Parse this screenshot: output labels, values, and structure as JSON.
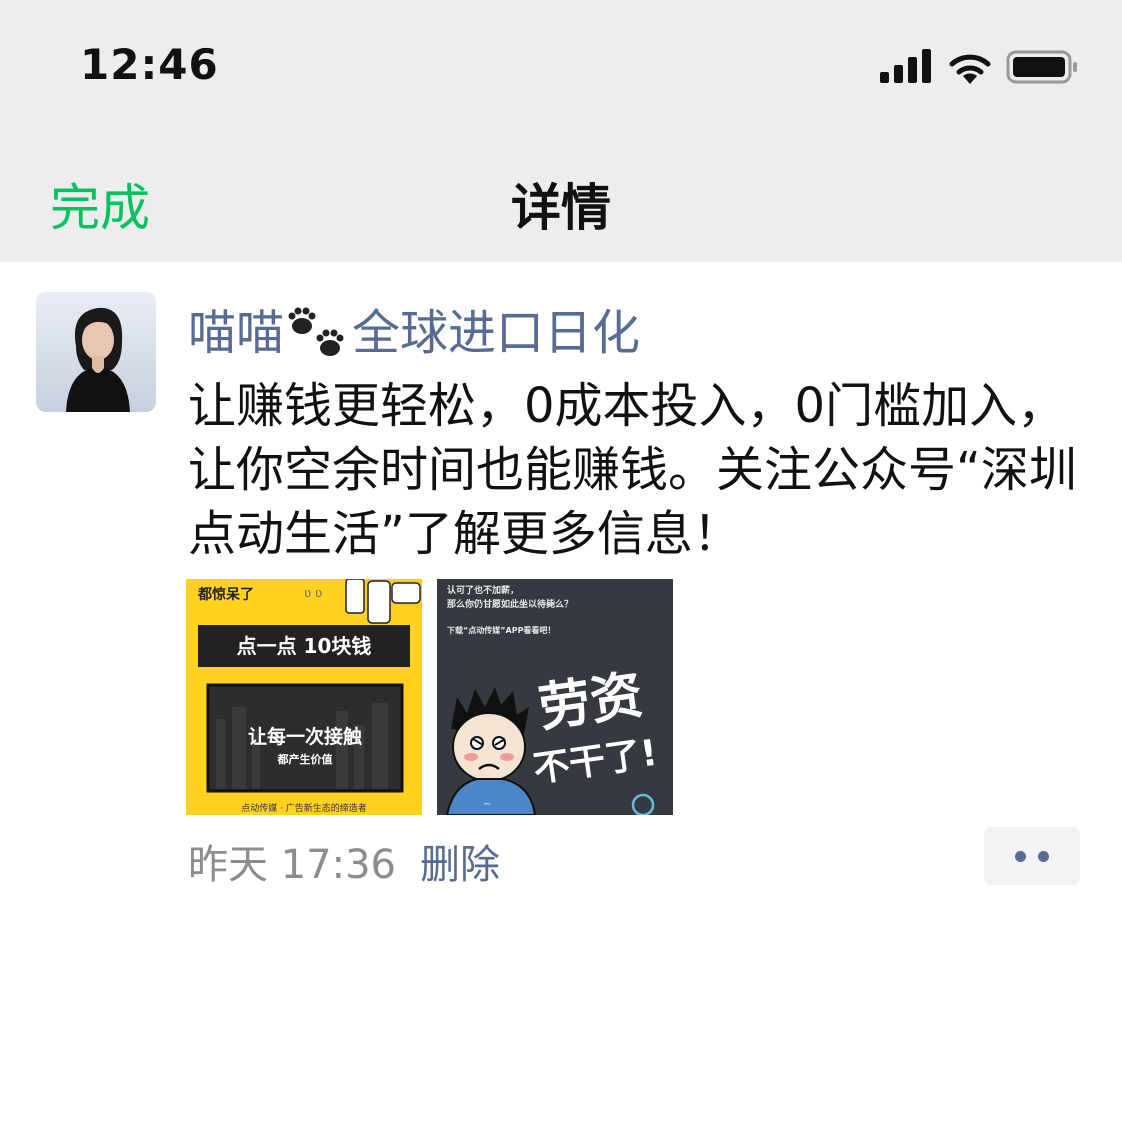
{
  "status_bar": {
    "time": "12:46",
    "icons": [
      "signal-icon",
      "wifi-icon",
      "battery-icon"
    ]
  },
  "nav": {
    "done_label": "完成",
    "title": "详情"
  },
  "post": {
    "username_part1": "喵喵",
    "username_part2": "全球进口日化",
    "text": "让赚钱更轻松，0成本投入，0门槛加入，让你空余时间也能赚钱。关注公众号“深圳点动生活”了解更多信息！",
    "time": "昨天 17:36",
    "delete_label": "删除"
  },
  "image1": {
    "top_label": "都惊呆了",
    "headline": "点一点 10块钱",
    "slogan": "让每一次接触",
    "sub_slogan": "都产生价值",
    "footer": "点动传媒 · 广告新生态的缔造者"
  },
  "image2": {
    "line1": "认可了也不加薪，",
    "line2": "那么你仍甘愿如此坐以待毙么？",
    "line3": "下载“点动传媒”APP看看吧！",
    "slogan1": "劳资",
    "slogan2": "不干了!"
  },
  "colors": {
    "accent_green": "#07c160",
    "link_blue": "#576b95",
    "nav_bg": "#ededed"
  }
}
